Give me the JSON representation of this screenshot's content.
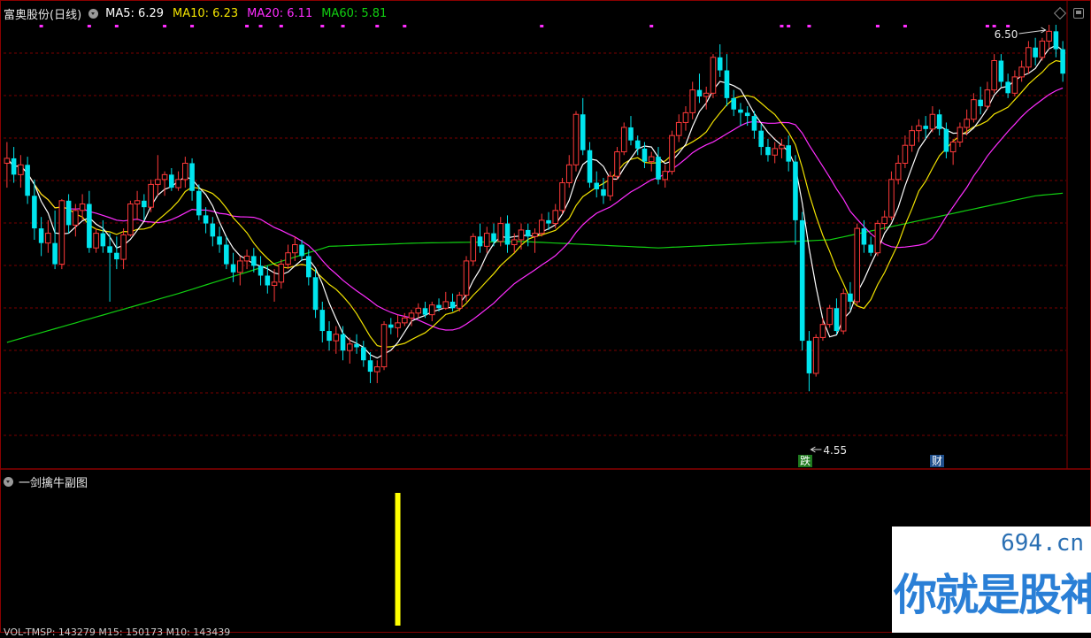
{
  "header": {
    "stock_title": "富奥股份(日线)",
    "ma_labels": [
      {
        "text": "MA5: 6.29",
        "color": "#ffffff"
      },
      {
        "text": "MA10: 6.23",
        "color": "#f2e300"
      },
      {
        "text": "MA20: 6.11",
        "color": "#ff2dff"
      },
      {
        "text": "MA60: 5.81",
        "color": "#11d011"
      }
    ]
  },
  "sub_panel": {
    "title": "一剑擒牛副图"
  },
  "bottom_text": "VOL-TMSP: 143279 M15: 150173 M10: 143439",
  "markers": {
    "die": "跌",
    "cai": "财"
  },
  "watermark": {
    "domain": "694.cn",
    "slogan": "你就是股神"
  },
  "colors": {
    "up": "#ff3a3a",
    "down": "#00e5ee",
    "ma5": "#ffffff",
    "ma10": "#f2e300",
    "ma20": "#ff2dff",
    "ma60": "#11d011",
    "sub_bar": "#ffff00"
  },
  "chart_data": {
    "type": "candlestick",
    "ylim": [
      4.1,
      6.8
    ],
    "high_label": "6.50",
    "low_label": "4.55",
    "candles": [
      [
        5.95,
        6.08,
        5.8,
        5.98
      ],
      [
        5.98,
        6.05,
        5.83,
        5.88
      ],
      [
        5.88,
        6.0,
        5.8,
        5.94
      ],
      [
        5.94,
        5.99,
        5.7,
        5.75
      ],
      [
        5.75,
        5.85,
        5.48,
        5.55
      ],
      [
        5.55,
        5.62,
        5.38,
        5.46
      ],
      [
        5.46,
        5.6,
        5.4,
        5.52
      ],
      [
        5.46,
        5.66,
        5.3,
        5.33
      ],
      [
        5.33,
        5.73,
        5.3,
        5.72
      ],
      [
        5.72,
        5.76,
        5.52,
        5.57
      ],
      [
        5.57,
        5.7,
        5.5,
        5.66
      ],
      [
        5.66,
        5.76,
        5.6,
        5.7
      ],
      [
        5.7,
        5.78,
        5.4,
        5.43
      ],
      [
        5.43,
        5.55,
        5.4,
        5.52
      ],
      [
        5.52,
        5.6,
        5.4,
        5.44
      ],
      [
        5.44,
        5.52,
        5.1,
        5.4
      ],
      [
        5.4,
        5.5,
        5.3,
        5.36
      ],
      [
        5.36,
        5.55,
        5.3,
        5.51
      ],
      [
        5.51,
        5.72,
        5.5,
        5.7
      ],
      [
        5.7,
        5.78,
        5.6,
        5.72
      ],
      [
        5.72,
        5.76,
        5.6,
        5.68
      ],
      [
        5.68,
        5.85,
        5.65,
        5.82
      ],
      [
        5.82,
        6.0,
        5.75,
        5.85
      ],
      [
        5.85,
        5.9,
        5.75,
        5.88
      ],
      [
        5.88,
        5.92,
        5.78,
        5.8
      ],
      [
        5.8,
        5.9,
        5.78,
        5.85
      ],
      [
        5.85,
        5.99,
        5.8,
        5.95
      ],
      [
        5.95,
        5.98,
        5.72,
        5.78
      ],
      [
        5.78,
        5.82,
        5.6,
        5.63
      ],
      [
        5.63,
        5.68,
        5.52,
        5.58
      ],
      [
        5.58,
        5.62,
        5.44,
        5.5
      ],
      [
        5.5,
        5.56,
        5.4,
        5.45
      ],
      [
        5.45,
        5.5,
        5.3,
        5.33
      ],
      [
        5.33,
        5.4,
        5.22,
        5.28
      ],
      [
        5.28,
        5.38,
        5.2,
        5.35
      ],
      [
        5.35,
        5.42,
        5.3,
        5.38
      ],
      [
        5.38,
        5.43,
        5.28,
        5.32
      ],
      [
        5.32,
        5.38,
        5.2,
        5.26
      ],
      [
        5.26,
        5.32,
        5.15,
        5.2
      ],
      [
        5.2,
        5.3,
        5.1,
        5.22
      ],
      [
        5.22,
        5.36,
        5.18,
        5.33
      ],
      [
        5.33,
        5.45,
        5.3,
        5.4
      ],
      [
        5.4,
        5.5,
        5.35,
        5.45
      ],
      [
        5.45,
        5.48,
        5.35,
        5.38
      ],
      [
        5.38,
        5.42,
        5.2,
        5.25
      ],
      [
        5.25,
        5.3,
        5.0,
        5.05
      ],
      [
        5.05,
        5.1,
        4.85,
        4.92
      ],
      [
        4.92,
        4.98,
        4.8,
        4.86
      ],
      [
        4.86,
        4.95,
        4.78,
        4.9
      ],
      [
        4.9,
        4.95,
        4.74,
        4.8
      ],
      [
        4.8,
        4.88,
        4.72,
        4.84
      ],
      [
        4.84,
        4.9,
        4.78,
        4.82
      ],
      [
        4.82,
        4.86,
        4.7,
        4.74
      ],
      [
        4.74,
        4.79,
        4.6,
        4.67
      ],
      [
        4.67,
        4.74,
        4.6,
        4.7
      ],
      [
        4.7,
        4.98,
        4.68,
        4.96
      ],
      [
        4.96,
        5.0,
        4.9,
        4.94
      ],
      [
        4.94,
        5.02,
        4.88,
        4.97
      ],
      [
        4.97,
        5.03,
        4.95,
        5.0
      ],
      [
        5.0,
        5.05,
        4.95,
        5.03
      ],
      [
        5.03,
        5.09,
        5.0,
        5.06
      ],
      [
        5.06,
        5.1,
        5.0,
        5.02
      ],
      [
        5.02,
        5.1,
        4.98,
        5.08
      ],
      [
        5.08,
        5.12,
        5.04,
        5.06
      ],
      [
        5.06,
        5.16,
        5.05,
        5.1
      ],
      [
        5.1,
        5.15,
        5.04,
        5.06
      ],
      [
        5.06,
        5.16,
        5.04,
        5.14
      ],
      [
        5.14,
        5.38,
        5.1,
        5.35
      ],
      [
        5.35,
        5.52,
        5.32,
        5.5
      ],
      [
        5.5,
        5.58,
        5.4,
        5.44
      ],
      [
        5.44,
        5.56,
        5.4,
        5.52
      ],
      [
        5.52,
        5.58,
        5.44,
        5.47
      ],
      [
        5.47,
        5.62,
        5.44,
        5.58
      ],
      [
        5.58,
        5.63,
        5.4,
        5.45
      ],
      [
        5.45,
        5.52,
        5.4,
        5.48
      ],
      [
        5.48,
        5.58,
        5.42,
        5.54
      ],
      [
        5.54,
        5.58,
        5.44,
        5.5
      ],
      [
        5.5,
        5.55,
        5.4,
        5.52
      ],
      [
        5.52,
        5.64,
        5.5,
        5.6
      ],
      [
        5.6,
        5.65,
        5.54,
        5.58
      ],
      [
        5.58,
        5.7,
        5.55,
        5.66
      ],
      [
        5.66,
        5.86,
        5.64,
        5.83
      ],
      [
        5.83,
        6.0,
        5.8,
        5.94
      ],
      [
        5.94,
        6.27,
        5.9,
        6.25
      ],
      [
        6.25,
        6.35,
        6.0,
        6.03
      ],
      [
        6.03,
        6.08,
        5.8,
        5.83
      ],
      [
        5.83,
        5.9,
        5.74,
        5.79
      ],
      [
        5.79,
        5.86,
        5.7,
        5.75
      ],
      [
        5.75,
        5.9,
        5.72,
        5.87
      ],
      [
        5.87,
        6.05,
        5.85,
        6.02
      ],
      [
        6.02,
        6.2,
        6.0,
        6.17
      ],
      [
        6.17,
        6.24,
        6.06,
        6.09
      ],
      [
        6.09,
        6.12,
        6.0,
        6.04
      ],
      [
        6.04,
        6.08,
        5.92,
        5.96
      ],
      [
        5.96,
        6.02,
        5.9,
        5.99
      ],
      [
        5.99,
        6.05,
        5.82,
        5.85
      ],
      [
        5.85,
        5.94,
        5.8,
        5.9
      ],
      [
        5.9,
        6.15,
        5.88,
        6.12
      ],
      [
        6.12,
        6.25,
        6.08,
        6.2
      ],
      [
        6.2,
        6.3,
        6.15,
        6.26
      ],
      [
        6.26,
        6.45,
        6.22,
        6.4
      ],
      [
        6.4,
        6.5,
        6.32,
        6.36
      ],
      [
        6.36,
        6.42,
        6.28,
        6.38
      ],
      [
        6.38,
        6.62,
        6.35,
        6.6
      ],
      [
        6.6,
        6.68,
        6.48,
        6.52
      ],
      [
        6.52,
        6.62,
        6.3,
        6.35
      ],
      [
        6.35,
        6.4,
        6.24,
        6.28
      ],
      [
        6.28,
        6.32,
        6.18,
        6.26
      ],
      [
        6.26,
        6.3,
        6.18,
        6.24
      ],
      [
        6.24,
        6.27,
        6.1,
        6.15
      ],
      [
        6.15,
        6.19,
        6.0,
        6.05
      ],
      [
        6.05,
        6.1,
        5.96,
        6.0
      ],
      [
        6.0,
        6.08,
        5.95,
        6.04
      ],
      [
        6.04,
        6.1,
        5.98,
        6.06
      ],
      [
        6.06,
        6.12,
        5.9,
        5.96
      ],
      [
        5.96,
        6.0,
        5.45,
        5.6
      ],
      [
        5.6,
        5.65,
        4.8,
        4.86
      ],
      [
        4.86,
        4.92,
        4.55,
        4.66
      ],
      [
        4.66,
        4.9,
        4.64,
        4.88
      ],
      [
        4.88,
        5.0,
        4.86,
        4.96
      ],
      [
        4.96,
        5.08,
        4.94,
        5.06
      ],
      [
        5.06,
        5.12,
        4.9,
        4.92
      ],
      [
        4.92,
        5.18,
        4.9,
        5.15
      ],
      [
        5.15,
        5.22,
        5.05,
        5.1
      ],
      [
        5.1,
        5.58,
        5.08,
        5.55
      ],
      [
        5.55,
        5.6,
        5.4,
        5.45
      ],
      [
        5.45,
        5.5,
        5.38,
        5.4
      ],
      [
        5.4,
        5.6,
        5.38,
        5.58
      ],
      [
        5.58,
        5.66,
        5.54,
        5.62
      ],
      [
        5.62,
        5.9,
        5.6,
        5.85
      ],
      [
        5.85,
        6.0,
        5.82,
        5.95
      ],
      [
        5.95,
        6.12,
        5.92,
        6.06
      ],
      [
        6.06,
        6.18,
        6.02,
        6.15
      ],
      [
        6.15,
        6.22,
        6.08,
        6.18
      ],
      [
        6.18,
        6.24,
        6.1,
        6.16
      ],
      [
        6.16,
        6.3,
        6.14,
        6.25
      ],
      [
        6.25,
        6.28,
        6.12,
        6.16
      ],
      [
        6.16,
        6.2,
        5.98,
        6.02
      ],
      [
        6.02,
        6.1,
        5.94,
        6.08
      ],
      [
        6.08,
        6.2,
        6.05,
        6.17
      ],
      [
        6.17,
        6.28,
        6.12,
        6.22
      ],
      [
        6.22,
        6.38,
        6.2,
        6.34
      ],
      [
        6.34,
        6.42,
        6.25,
        6.3
      ],
      [
        6.3,
        6.45,
        6.28,
        6.4
      ],
      [
        6.4,
        6.62,
        6.38,
        6.58
      ],
      [
        6.58,
        6.62,
        6.42,
        6.45
      ],
      [
        6.45,
        6.5,
        6.35,
        6.38
      ],
      [
        6.38,
        6.52,
        6.36,
        6.48
      ],
      [
        6.48,
        6.58,
        6.45,
        6.54
      ],
      [
        6.54,
        6.7,
        6.5,
        6.66
      ],
      [
        6.66,
        6.72,
        6.55,
        6.6
      ],
      [
        6.6,
        6.72,
        6.58,
        6.7
      ],
      [
        6.7,
        6.8,
        6.65,
        6.76
      ],
      [
        6.76,
        6.8,
        6.6,
        6.65
      ],
      [
        6.65,
        6.7,
        6.45,
        6.5
      ]
    ],
    "ma60": [
      [
        0,
        4.85
      ],
      [
        25,
        5.15
      ],
      [
        47,
        5.44
      ],
      [
        60,
        5.46
      ],
      [
        75,
        5.47
      ],
      [
        95,
        5.43
      ],
      [
        120,
        5.48
      ],
      [
        150,
        5.75
      ],
      [
        175,
        5.85
      ],
      [
        195,
        6.05
      ],
      [
        215,
        6.28
      ]
    ],
    "sub_bars": [
      {
        "index": 57,
        "value": 1.0
      }
    ],
    "top_dots": [
      5,
      12,
      16,
      23,
      27,
      35,
      37,
      40,
      46,
      49,
      54,
      58,
      78,
      94,
      113,
      114,
      117,
      127,
      131,
      143,
      144,
      146,
      159,
      164,
      168,
      175,
      176,
      183
    ]
  }
}
